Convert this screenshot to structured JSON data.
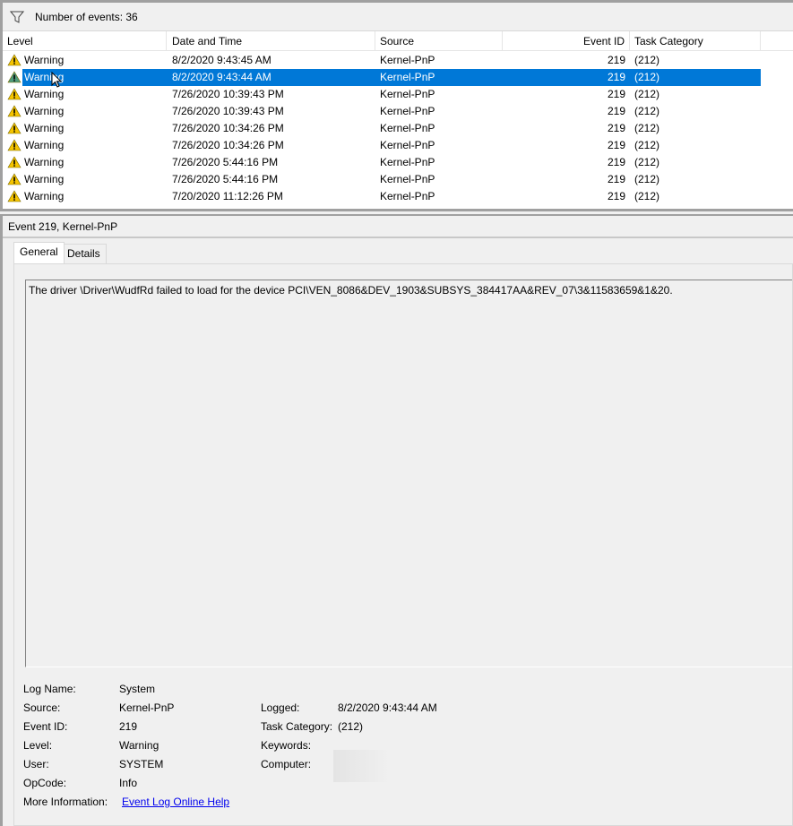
{
  "filter_bar": {
    "icon": "filter-icon",
    "label": "Number of events: 36"
  },
  "columns": [
    "Level",
    "Date and Time",
    "Source",
    "Event ID",
    "Task Category"
  ],
  "rows": [
    {
      "level": "Warning",
      "datetime": "8/2/2020 9:43:45 AM",
      "source": "Kernel-PnP",
      "event_id": "219",
      "category": "(212)"
    },
    {
      "level": "Warning",
      "datetime": "8/2/2020 9:43:44 AM",
      "source": "Kernel-PnP",
      "event_id": "219",
      "category": "(212)",
      "selected": true
    },
    {
      "level": "Warning",
      "datetime": "7/26/2020 10:39:43 PM",
      "source": "Kernel-PnP",
      "event_id": "219",
      "category": "(212)"
    },
    {
      "level": "Warning",
      "datetime": "7/26/2020 10:39:43 PM",
      "source": "Kernel-PnP",
      "event_id": "219",
      "category": "(212)"
    },
    {
      "level": "Warning",
      "datetime": "7/26/2020 10:34:26 PM",
      "source": "Kernel-PnP",
      "event_id": "219",
      "category": "(212)"
    },
    {
      "level": "Warning",
      "datetime": "7/26/2020 10:34:26 PM",
      "source": "Kernel-PnP",
      "event_id": "219",
      "category": "(212)"
    },
    {
      "level": "Warning",
      "datetime": "7/26/2020 5:44:16 PM",
      "source": "Kernel-PnP",
      "event_id": "219",
      "category": "(212)"
    },
    {
      "level": "Warning",
      "datetime": "7/26/2020 5:44:16 PM",
      "source": "Kernel-PnP",
      "event_id": "219",
      "category": "(212)"
    },
    {
      "level": "Warning",
      "datetime": "7/20/2020 11:12:26 PM",
      "source": "Kernel-PnP",
      "event_id": "219",
      "category": "(212)"
    }
  ],
  "detail": {
    "title": "Event 219, Kernel-PnP",
    "tabs": [
      "General",
      "Details"
    ],
    "message": "The driver \\Driver\\WudfRd failed to load for the device PCI\\VEN_8086&DEV_1903&SUBSYS_384417AA&REV_07\\3&11583659&1&20.",
    "fields": {
      "log_name_label": "Log Name:",
      "log_name": "System",
      "source_label": "Source:",
      "source": "Kernel-PnP",
      "event_id_label": "Event ID:",
      "event_id": "219",
      "level_label": "Level:",
      "level": "Warning",
      "user_label": "User:",
      "user": "SYSTEM",
      "opcode_label": "OpCode:",
      "opcode": "Info",
      "more_info_label": "More Information:",
      "more_info_link": "Event Log Online Help",
      "logged_label": "Logged:",
      "logged": "8/2/2020 9:43:44 AM",
      "task_category_label": "Task Category:",
      "task_category": "(212)",
      "keywords_label": "Keywords:",
      "computer_label": "Computer:"
    }
  },
  "colors": {
    "selection": "#0078d7",
    "warning": "#f5c400",
    "link": "#0000ee"
  }
}
